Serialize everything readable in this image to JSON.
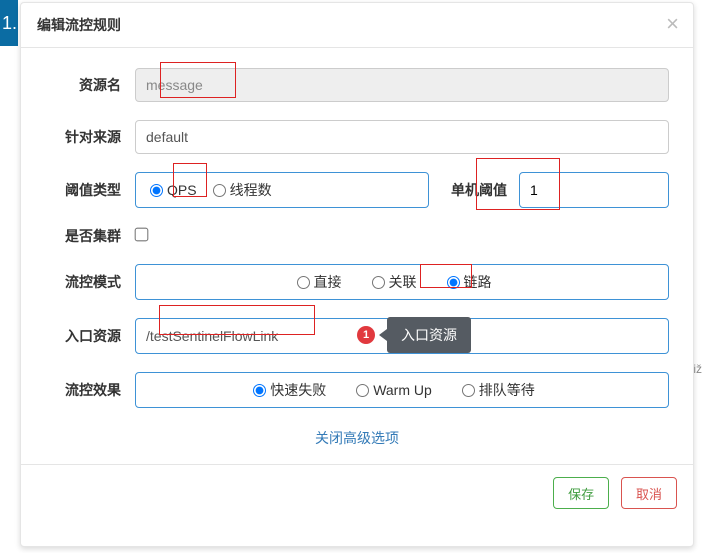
{
  "bg_marker": "1.",
  "header": {
    "title": "编辑流控规则",
    "close_glyph": "×"
  },
  "labels": {
    "resource": "资源名",
    "origin": "针对来源",
    "threshold_type": "阈值类型",
    "single_threshold": "单机阈值",
    "cluster": "是否集群",
    "mode": "流控模式",
    "entry": "入口资源",
    "effect": "流控效果"
  },
  "values": {
    "resource": "message",
    "origin": "default",
    "threshold": "1",
    "entry": "/testSentinelFlowLink"
  },
  "threshold_type": {
    "options": [
      {
        "label": "QPS",
        "checked": true
      },
      {
        "label": "线程数",
        "checked": false
      }
    ]
  },
  "mode": {
    "options": [
      {
        "label": "直接",
        "checked": false
      },
      {
        "label": "关联",
        "checked": false
      },
      {
        "label": "链路",
        "checked": true
      }
    ]
  },
  "effect": {
    "options": [
      {
        "label": "快速失败",
        "checked": true
      },
      {
        "label": "Warm Up",
        "checked": false
      },
      {
        "label": "排队等待",
        "checked": false
      }
    ]
  },
  "tooltip": {
    "badge": "1",
    "text": "入口资源"
  },
  "collapse_link": "关闭高级选项",
  "footer": {
    "save": "保存",
    "cancel": "取消"
  },
  "side_char": "iž"
}
